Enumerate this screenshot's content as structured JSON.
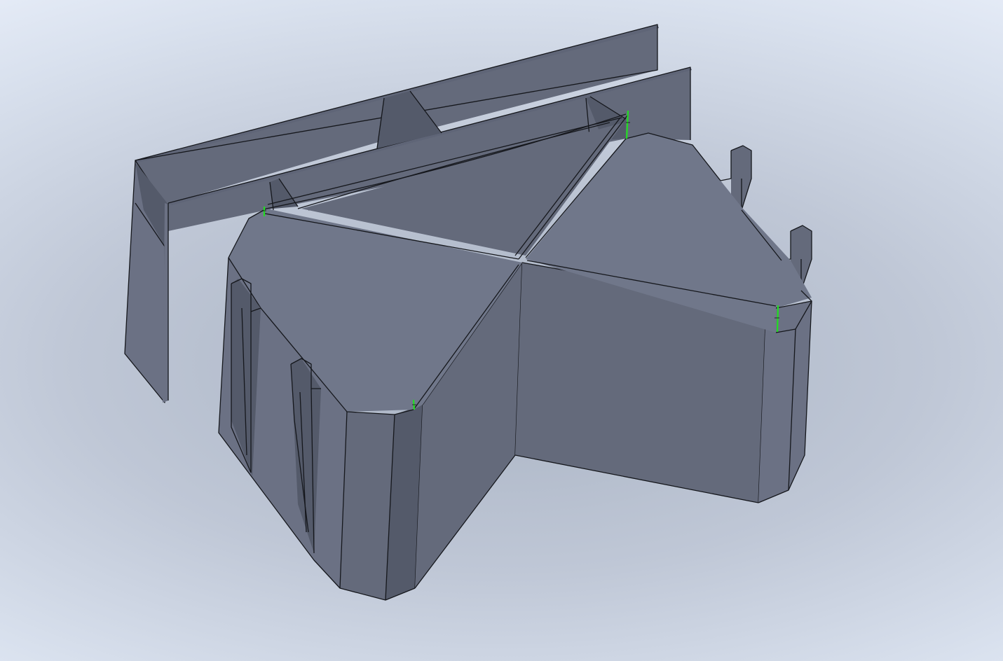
{
  "viewport": {
    "background_top": "#e8eef9",
    "background_center": "#a9b3c3"
  },
  "model": {
    "face_color": "#70778a",
    "edge_color": "#15171c",
    "highlight_color": "#22dd22",
    "selected_edges": 4
  }
}
